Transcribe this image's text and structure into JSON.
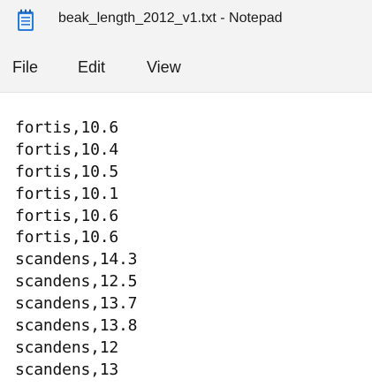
{
  "window": {
    "title": "beak_length_2012_v1.txt - Notepad",
    "icon": "notepad-icon"
  },
  "menu": {
    "file": "File",
    "edit": "Edit",
    "view": "View"
  },
  "editor": {
    "lines": [
      "fortis,10.6",
      "fortis,10.4",
      "fortis,10.5",
      "fortis,10.1",
      "fortis,10.6",
      "fortis,10.6",
      "scandens,14.3",
      "scandens,12.5",
      "scandens,13.7",
      "scandens,13.8",
      "scandens,12",
      "scandens,13"
    ]
  },
  "colors": {
    "chrome_background": "#f3f3f3",
    "editor_background": "#ffffff",
    "text": "#111111",
    "icon_accent": "#2b7bd8"
  }
}
